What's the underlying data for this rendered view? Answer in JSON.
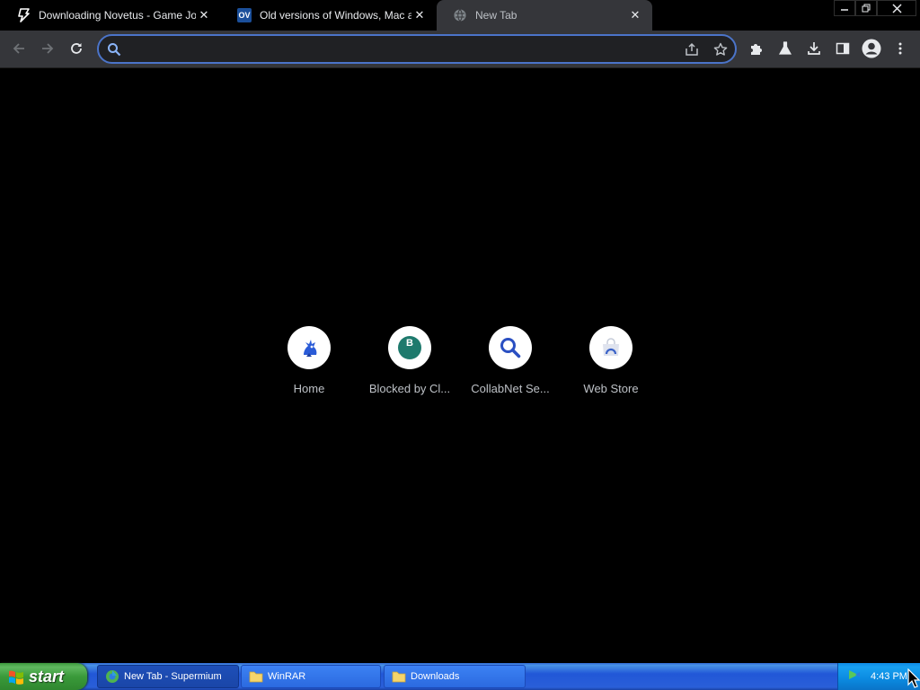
{
  "tabs": [
    {
      "title": "Downloading Novetus - Game Jolt",
      "icon": "gamejolt-icon",
      "active": false
    },
    {
      "title": "Old versions of Windows, Mac and L",
      "icon": "oldversion-icon",
      "favicon_text": "OV",
      "active": false
    },
    {
      "title": "New Tab",
      "icon": "globe-icon",
      "active": true
    }
  ],
  "omnibox": {
    "value": "",
    "placeholder": ""
  },
  "shortcuts": [
    {
      "label": "Home",
      "icon": "home-mascot-icon"
    },
    {
      "label": "Blocked by Cl...",
      "icon": "letter-b-icon",
      "letter": "B"
    },
    {
      "label": "CollabNet Se...",
      "icon": "magnifier-icon"
    },
    {
      "label": "Web Store",
      "icon": "web-store-icon"
    }
  ],
  "taskbar": {
    "start_label": "start",
    "tasks": [
      {
        "label": "New Tab - Supermium",
        "icon": "browser-icon",
        "active": true
      },
      {
        "label": "WinRAR",
        "icon": "folder-icon",
        "active": false
      },
      {
        "label": "Downloads",
        "icon": "folder-icon",
        "active": false
      }
    ],
    "clock": "4:43 PM"
  },
  "colors": {
    "accent": "#4b74c9",
    "toolbar": "#35363a",
    "background": "#000000",
    "tile_b": "#1e7a6d",
    "taskbar_blue": "#2157d7",
    "start_green": "#3a9a3a"
  }
}
